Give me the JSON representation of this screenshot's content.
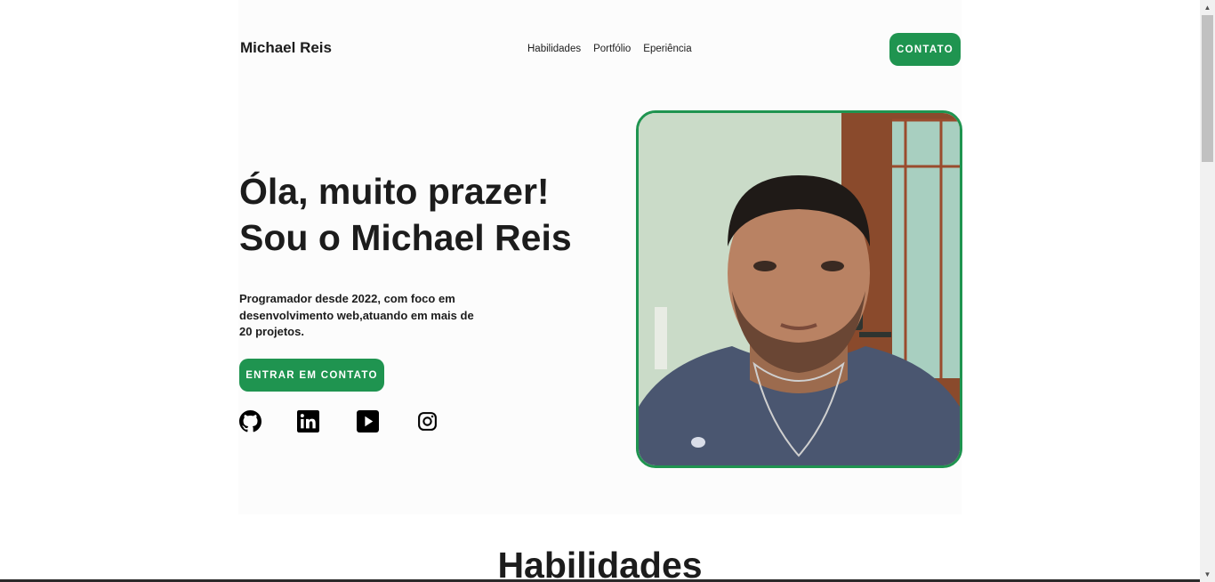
{
  "header": {
    "brand": "Michael Reis",
    "nav": [
      "Habilidades",
      "Portfólio",
      "Eperiência"
    ],
    "contact_button": "CONTATO"
  },
  "hero": {
    "title_line1": "Óla, muito prazer!",
    "title_line2": "Sou o Michael Reis",
    "description": "Programador desde 2022, com foco em desenvolvimento web,atuando em mais de 20 projetos.",
    "cta_button": "ENTRAR EM CONTATO",
    "socials": [
      "github-icon",
      "linkedin-icon",
      "youtube-icon",
      "instagram-icon"
    ]
  },
  "sections": {
    "skills_title": "Habilidades"
  },
  "colors": {
    "accent": "#1f9450",
    "text": "#1c1c1c",
    "hero_background": "#fcfcfc"
  }
}
